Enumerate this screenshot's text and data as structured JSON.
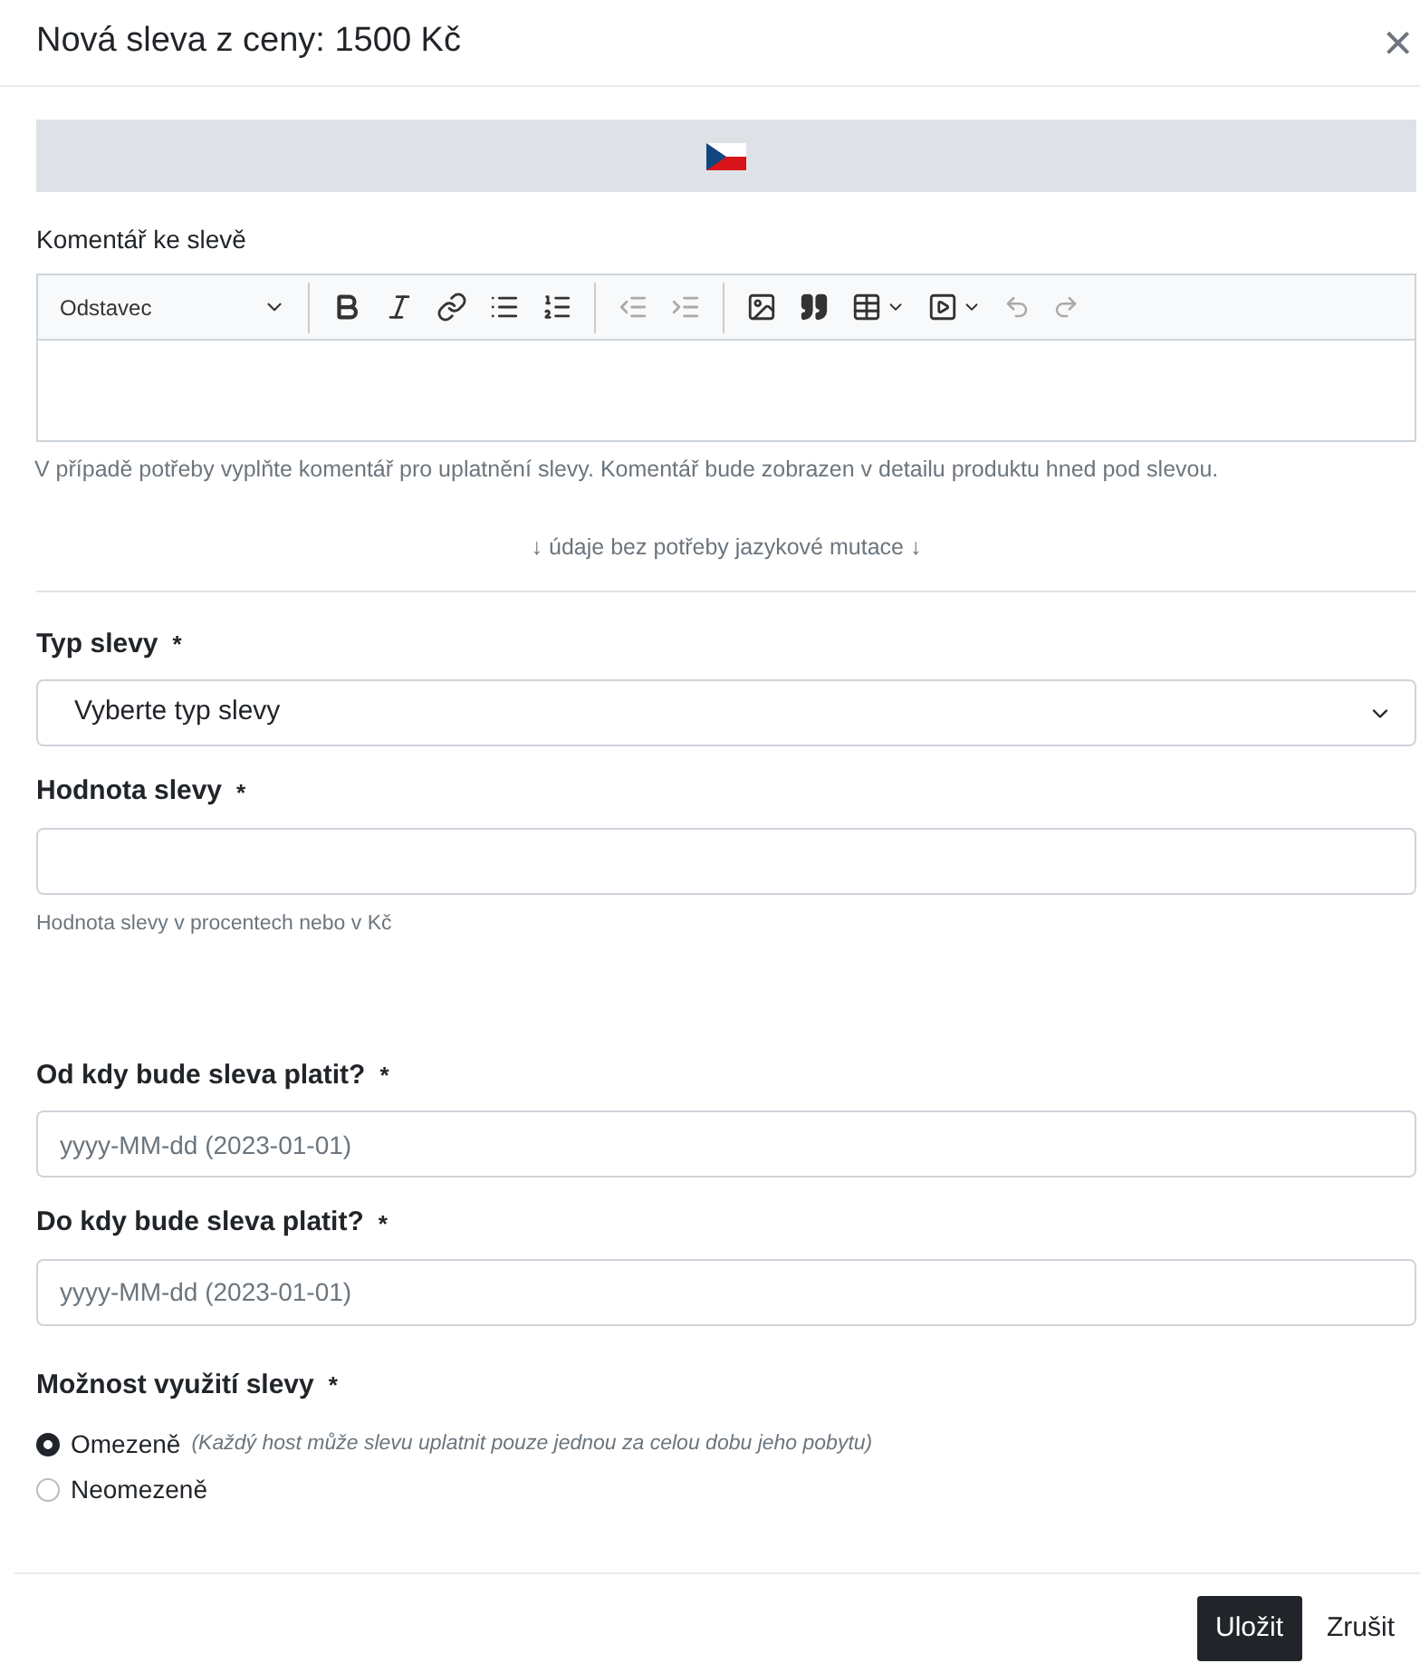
{
  "dialog": {
    "title": "Nová sleva z ceny: 1500 Kč",
    "close": "×"
  },
  "comment": {
    "label": "Komentář ke slevě",
    "format_select": "Odstavec",
    "help": "V případě potřeby vyplňte komentář pro uplatnění slevy. Komentář bude zobrazen v detailu produktu hned pod slevou."
  },
  "separator_note": "↓ údaje bez potřeby jazykové mutace ↓",
  "fields": [
    {
      "kind": "select",
      "label": "Typ slevy",
      "required_mark": "*",
      "value": "Vyberte typ slevy"
    },
    {
      "kind": "input",
      "label": "Hodnota slevy",
      "required_mark": "*",
      "help": "Hodnota slevy v procentech nebo v Kč"
    },
    {
      "kind": "input",
      "label": "Od kdy bude sleva platit?",
      "required_mark": "*",
      "placeholder": "yyyy-MM-dd (2023-01-01)"
    },
    {
      "kind": "input",
      "label": "Do kdy bude sleva platit?",
      "required_mark": "*",
      "placeholder": "yyyy-MM-dd (2023-01-01)"
    }
  ],
  "usage": {
    "label": "Možnost využití slevy",
    "required_mark": "*",
    "options": [
      {
        "label": "Omezeně",
        "note": "(Každý host může slevu uplatnit pouze jednou za celou dobu jeho pobytu)",
        "selected": true
      },
      {
        "label": "Neomezeně",
        "selected": false
      }
    ]
  },
  "buttons": [
    "Uložit",
    "Zrušit"
  ]
}
